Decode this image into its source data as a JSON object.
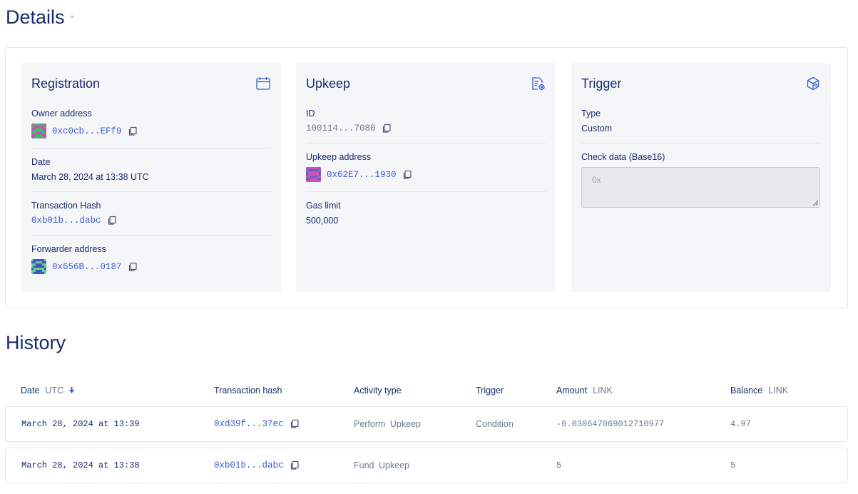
{
  "details": {
    "title": "Details",
    "registration": {
      "title": "Registration",
      "icon": "calendar-icon",
      "owner_label": "Owner address",
      "owner_value": "0xc0cb...EFf9",
      "date_label": "Date",
      "date_value": "March 28, 2024 at 13:38 UTC",
      "tx_label": "Transaction Hash",
      "tx_value": "0xb01b...dabc",
      "forwarder_label": "Forwarder address",
      "forwarder_value": "0x656B...0187"
    },
    "upkeep": {
      "title": "Upkeep",
      "icon": "document-settings-icon",
      "id_label": "ID",
      "id_value": "100114...7080",
      "address_label": "Upkeep address",
      "address_value": "0x62E7...1930",
      "gas_label": "Gas limit",
      "gas_value": "500,000"
    },
    "trigger": {
      "title": "Trigger",
      "icon": "cube-icon",
      "type_label": "Type",
      "type_value": "Custom",
      "check_label": "Check data (Base16)",
      "check_placeholder": "0x"
    }
  },
  "history": {
    "title": "History",
    "columns": {
      "date": "Date",
      "date_unit": "UTC",
      "hash": "Transaction hash",
      "activity": "Activity type",
      "trigger": "Trigger",
      "amount": "Amount",
      "amount_unit": "LINK",
      "balance": "Balance",
      "balance_unit": "LINK"
    },
    "rows": [
      {
        "date": "March 28, 2024 at 13:39",
        "hash": "0xd39f...37ec",
        "activity": "Perform Upkeep",
        "trigger": "Condition",
        "amount": "-0.030647069012710977",
        "balance": "4.97"
      },
      {
        "date": "March 28, 2024 at 13:38",
        "hash": "0xb01b...dabc",
        "activity": "Fund Upkeep",
        "trigger": "",
        "amount": "5",
        "balance": "5"
      }
    ]
  },
  "colors": {
    "heading": "#1a2b6b",
    "link": "#375bd2",
    "muted": "#6b7890",
    "card_bg": "#f5f6f8"
  }
}
